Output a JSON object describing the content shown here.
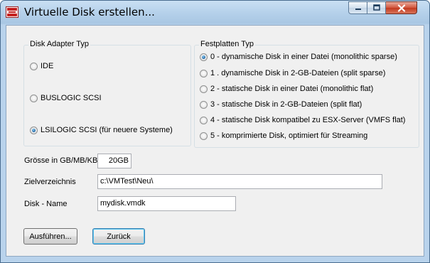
{
  "window": {
    "title": "Virtuelle Disk erstellen..."
  },
  "adapter_group": {
    "label": "Disk Adapter Typ",
    "options": [
      {
        "label": "IDE",
        "checked": false
      },
      {
        "label": "BUSLOGIC SCSI",
        "checked": false
      },
      {
        "label": "LSILOGIC SCSI (für neuere Systeme)",
        "checked": true
      }
    ]
  },
  "disk_type_group": {
    "label": "Festplatten Typ",
    "options": [
      {
        "label": "0 - dynamische Disk in einer Datei (monolithic sparse)",
        "checked": true
      },
      {
        "label": "1 . dynamische Disk in 2-GB-Dateien (split sparse)",
        "checked": false
      },
      {
        "label": "2 - statische Disk in einer Datei (monolithic flat)",
        "checked": false
      },
      {
        "label": "3 - statische Disk in 2-GB-Dateien (split flat)",
        "checked": false
      },
      {
        "label": "4 - statische Disk kompatibel zu ESX-Server (VMFS flat)",
        "checked": false
      },
      {
        "label": "5 - komprimierte Disk, optimiert für Streaming",
        "checked": false
      }
    ]
  },
  "form": {
    "size_label": "Grösse in GB/MB/KB",
    "size_value": "20GB",
    "target_label": "Zielverzeichnis",
    "target_value": "c:\\VMTest\\Neu\\",
    "name_label": "Disk - Name",
    "name_value": "mydisk.vmdk"
  },
  "buttons": {
    "run": "Ausführen...",
    "back": "Zurück"
  }
}
